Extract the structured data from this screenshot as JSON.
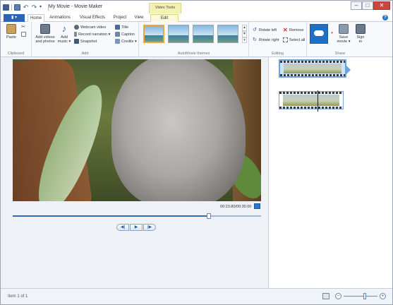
{
  "window": {
    "title": "My Movie - Movie Maker",
    "context_tab_header": "Video Tools",
    "buttons": {
      "minimize": "–",
      "maximize": "□",
      "close": "✕"
    }
  },
  "quick_access": {
    "dropdown": "▾"
  },
  "tabs": {
    "file": "▮ ▾",
    "items": [
      "Home",
      "Animations",
      "Visual Effects",
      "Project",
      "View",
      "Edit"
    ],
    "active": "Home",
    "help": "?"
  },
  "ribbon": {
    "clipboard": {
      "label": "Clipboard",
      "paste": "Paste"
    },
    "add": {
      "label": "Add",
      "add_videos_line1": "Add videos",
      "add_videos_line2": "and photos",
      "add_music_line1": "Add",
      "add_music_line2": "music ▾",
      "webcam": "Webcam video",
      "record": "Record narration ▾",
      "snapshot": "Snapshot",
      "title": "Title",
      "caption": "Caption",
      "credits": "Credits ▾"
    },
    "themes": {
      "label": "AutoMovie themes",
      "scroll_up": "▲",
      "scroll_down": "▼",
      "more": "▾"
    },
    "editing": {
      "label": "Editing",
      "rotate_left": "Rotate left",
      "rotate_right": "Rotate right",
      "remove": "Remove",
      "select_all": "Select all"
    },
    "share": {
      "label": "Share",
      "save_movie_line1": "Save",
      "save_movie_line2": "movie ▾",
      "sign_in_line1": "Sign",
      "sign_in_line2": "in"
    }
  },
  "player": {
    "timecode": "00:23.80/00:30.00",
    "progress_fraction": 0.79,
    "prev_frame": "◀|",
    "play": "▶",
    "next_frame": "|▶"
  },
  "status": {
    "text": "Item 1 of 1",
    "zoom_out": "−",
    "zoom_in": "+",
    "zoom_fraction": 0.62
  },
  "colors": {
    "file_button": "#2b63b8",
    "accent": "#2f6ab7",
    "context_tab": "#f4f1b4",
    "selected_theme": "#f0a63a"
  }
}
